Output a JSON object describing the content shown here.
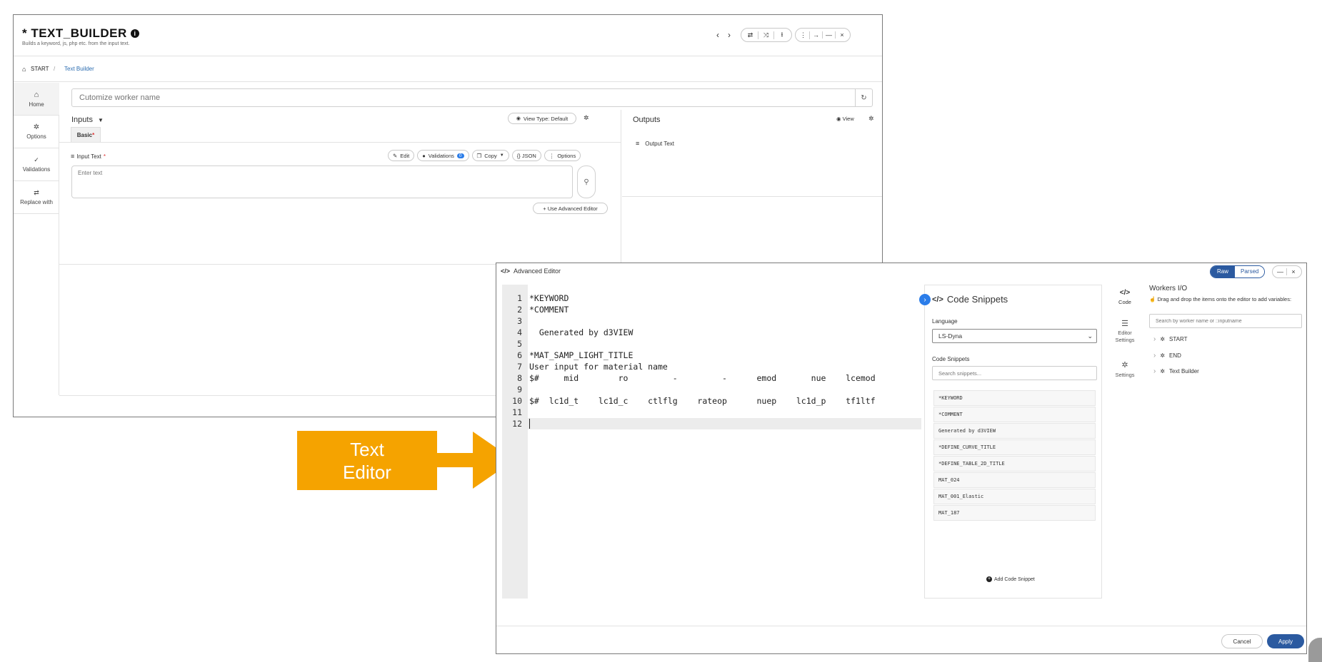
{
  "back_window": {
    "title": "* TEXT_BUILDER",
    "subtitle": "Builds a keyword, js, php etc. from the input text.",
    "breadcrumb": {
      "home": "START",
      "sep": "/",
      "current": "Text Builder"
    },
    "sidebar": [
      {
        "icon": "home-icon",
        "label": "Home"
      },
      {
        "icon": "gear-icon",
        "label": "Options"
      },
      {
        "icon": "check-icon",
        "label": "Validations"
      },
      {
        "icon": "swap-icon",
        "label": "Replace with"
      }
    ],
    "worker_name_placeholder": "Cutomize worker name",
    "inputs": {
      "heading": "Inputs",
      "view_type": "View Type: Default",
      "tab_basic": "Basic",
      "field_label": "Input Text",
      "buttons": {
        "edit": "Edit",
        "validations": "Validations",
        "validations_count": "0",
        "copy": "Copy",
        "json": "{} JSON",
        "options": "Options"
      },
      "textarea_placeholder": "Enter text",
      "advanced_button": "+ Use Advanced Editor"
    },
    "outputs": {
      "heading": "Outputs",
      "view": "View",
      "item": "Output Text"
    }
  },
  "callout": {
    "line1": "Text",
    "line2": "Editor",
    "color": "#f5a300"
  },
  "advanced_editor": {
    "title": "Advanced Editor",
    "toggle": {
      "raw": "Raw",
      "parsed": "Parsed"
    },
    "code_lines": [
      "*KEYWORD",
      "*COMMENT",
      "",
      "  Generated by d3VIEW",
      "",
      "*MAT_SAMP_LIGHT_TITLE",
      "User input for material name",
      "$#     mid        ro         -         -      emod       nue    lcemod",
      "",
      "$#  lc1d_t    lc1d_c    ctlflg    rateop      nuep    lc1d_p    tf1ltf",
      "",
      ""
    ],
    "line_numbers": [
      "1",
      "2",
      "3",
      "4",
      "5",
      "6",
      "7",
      "8",
      "9",
      "10",
      "11",
      "12"
    ],
    "snippets_panel": {
      "title": "Code Snippets",
      "language_label": "Language",
      "language_value": "LS-Dyna",
      "snippets_label": "Code Snippets",
      "search_placeholder": "Search snippets...",
      "items": [
        "*KEYWORD",
        "*COMMENT",
        "Generated by d3VIEW",
        "*DEFINE_CURVE_TITLE",
        "*DEFINE_TABLE_2D_TITLE",
        "MAT_024",
        "MAT_001_Elastic",
        "MAT_187"
      ],
      "add_button": "Add Code Snippet"
    },
    "side_tabs": [
      {
        "icon": "code-icon",
        "label": "Code"
      },
      {
        "icon": "sliders-icon",
        "label": "Editor Settings"
      },
      {
        "icon": "gear-icon",
        "label": "Settings"
      }
    ],
    "workers_io": {
      "title": "Workers I/O",
      "hint": "Drag and drop the items onto the editor to add variables:",
      "search_placeholder": "Search by worker name or ::inputname",
      "tree": [
        "START",
        "END",
        "Text Builder"
      ]
    },
    "footer": {
      "cancel": "Cancel",
      "apply": "Apply"
    },
    "accent": "#2b5aa0"
  }
}
